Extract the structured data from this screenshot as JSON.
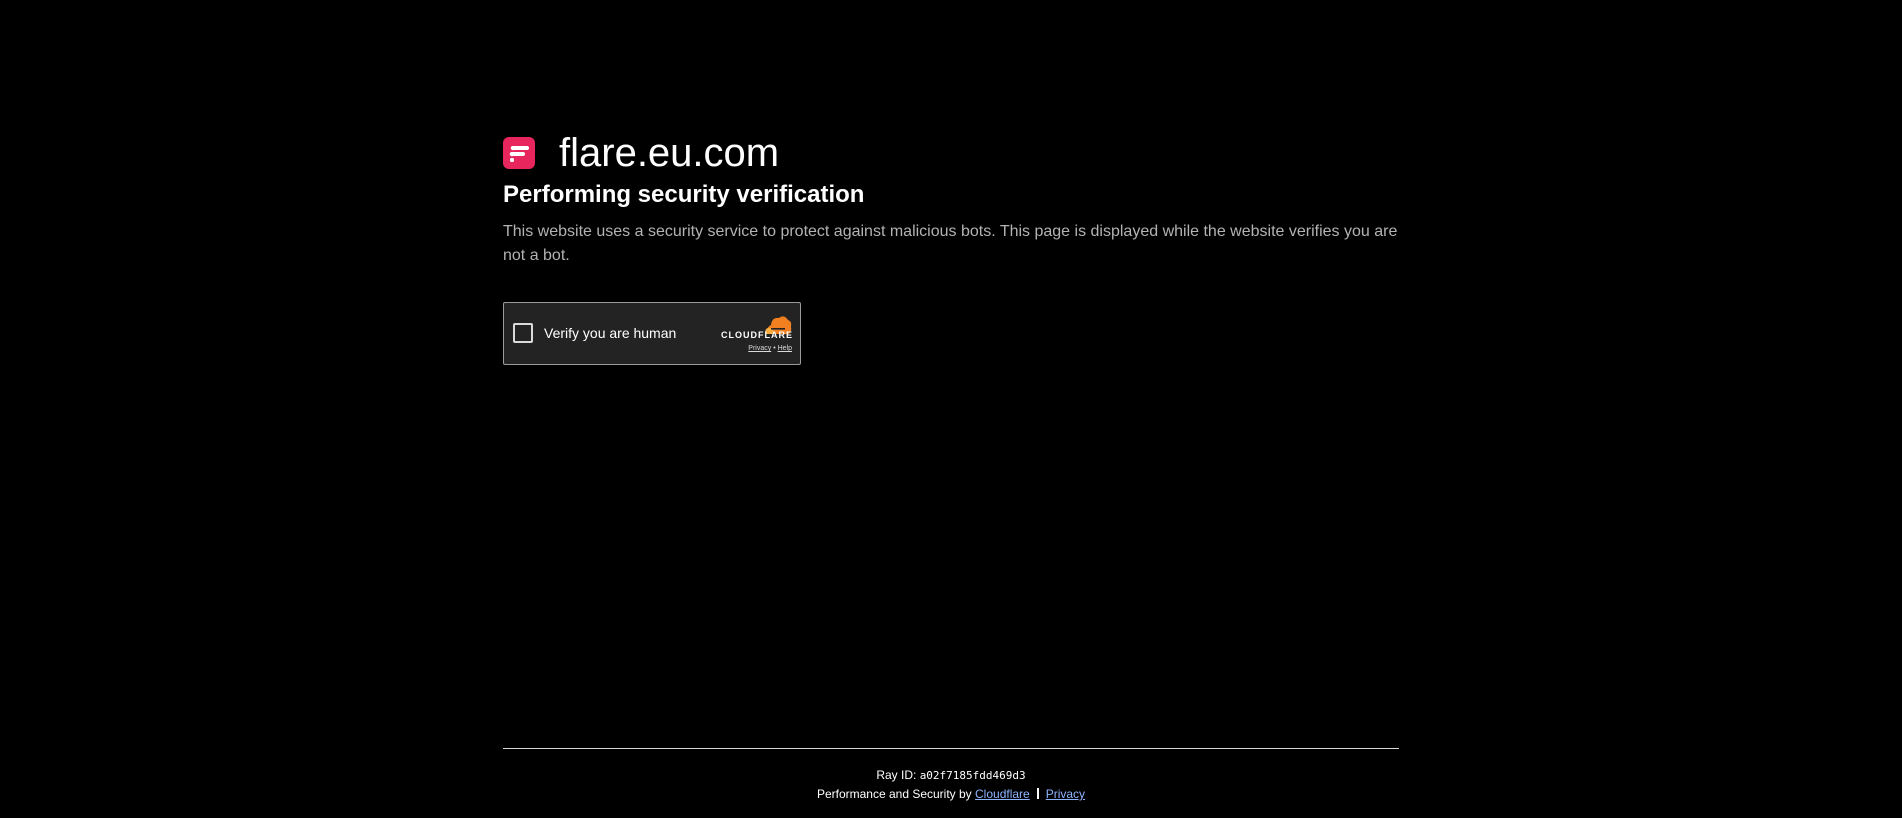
{
  "site": {
    "name": "flare.eu.com",
    "logo_icon": "flare-logo-icon",
    "logo_color": "#e8265e"
  },
  "heading": "Performing security verification",
  "description": "This website uses a security service to protect against malicious bots. This page is displayed while the website verifies you are not a bot.",
  "widget": {
    "checkbox_label": "Verify you are human",
    "brand": "CLOUDFLARE",
    "brand_color": "#f38020",
    "privacy_link": "Privacy",
    "separator": "•",
    "help_link": "Help"
  },
  "footer": {
    "ray_label": "Ray ID: ",
    "ray_id": "a02f7185fdd469d3",
    "performance_text": "Performance and Security by ",
    "cloudflare_link": "Cloudflare",
    "privacy_link": "Privacy",
    "link_color": "#8fb4ff"
  }
}
